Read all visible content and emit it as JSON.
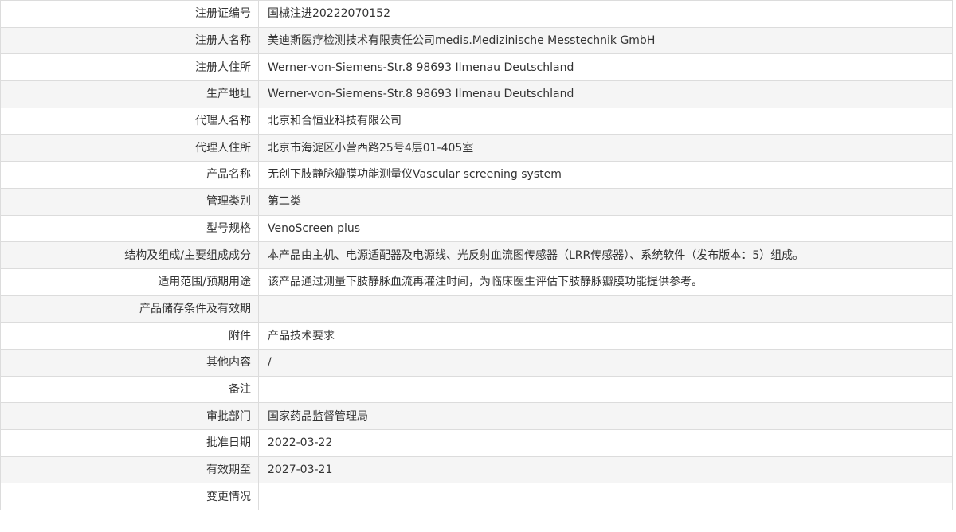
{
  "rows": [
    {
      "label": "注册证编号",
      "value": "国械注进20222070152"
    },
    {
      "label": "注册人名称",
      "value": "美迪斯医疗检测技术有限责任公司medis.Medizinische Messtechnik GmbH"
    },
    {
      "label": "注册人住所",
      "value": "Werner-von-Siemens-Str.8 98693 Ilmenau Deutschland"
    },
    {
      "label": "生产地址",
      "value": "Werner-von-Siemens-Str.8 98693 Ilmenau Deutschland"
    },
    {
      "label": "代理人名称",
      "value": "北京和合恒业科技有限公司"
    },
    {
      "label": "代理人住所",
      "value": "北京市海淀区小营西路25号4层01-405室"
    },
    {
      "label": "产品名称",
      "value": "无创下肢静脉瓣膜功能测量仪Vascular screening system"
    },
    {
      "label": "管理类别",
      "value": "第二类"
    },
    {
      "label": "型号规格",
      "value": "VenoScreen plus"
    },
    {
      "label": "结构及组成/主要组成成分",
      "value": "本产品由主机、电源适配器及电源线、光反射血流图传感器（LRR传感器）、系统软件（发布版本：5）组成。"
    },
    {
      "label": "适用范围/预期用途",
      "value": "该产品通过测量下肢静脉血流再灌注时间，为临床医生评估下肢静脉瓣膜功能提供参考。"
    },
    {
      "label": "产品储存条件及有效期",
      "value": ""
    },
    {
      "label": "附件",
      "value": "产品技术要求"
    },
    {
      "label": "其他内容",
      "value": "/"
    },
    {
      "label": "备注",
      "value": ""
    },
    {
      "label": "审批部门",
      "value": "国家药品监督管理局"
    },
    {
      "label": "批准日期",
      "value": "2022-03-22"
    },
    {
      "label": "有效期至",
      "value": "2027-03-21"
    },
    {
      "label": "变更情况",
      "value": ""
    }
  ]
}
